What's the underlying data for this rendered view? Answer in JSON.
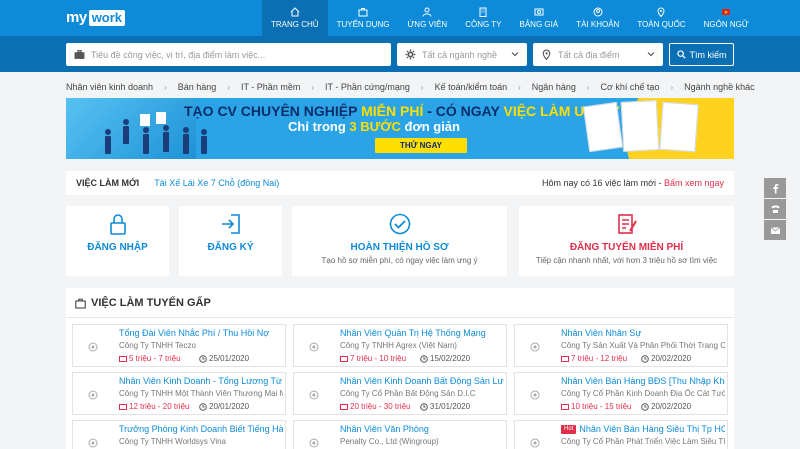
{
  "logo": {
    "my": "my",
    "work": "work"
  },
  "nav": [
    {
      "label": "TRANG CHỦ",
      "icon": "home-icon",
      "active": true
    },
    {
      "label": "TUYỂN DỤNG",
      "icon": "briefcase-icon"
    },
    {
      "label": "ỨNG VIÊN",
      "icon": "user-icon"
    },
    {
      "label": "CÔNG TY",
      "icon": "building-icon"
    },
    {
      "label": "BẢNG GIÁ",
      "icon": "price-icon"
    },
    {
      "label": "TÀI KHOẢN",
      "icon": "account-icon"
    },
    {
      "label": "TOÀN QUỐC",
      "icon": "location-icon"
    },
    {
      "label": "NGÔN NGỮ",
      "icon": "flag-icon"
    }
  ],
  "search": {
    "keyword_placeholder": "Tiêu đề công việc, vị trí, địa điểm làm việc...",
    "industry_placeholder": "Tất cả ngành nghề",
    "location_placeholder": "Tất cả địa điểm",
    "button_label": "Tìm kiếm"
  },
  "categories": [
    "Nhân viên kinh doanh",
    "Bán hàng",
    "IT - Phần mềm",
    "IT - Phần cứng/mạng",
    "Kế toán/kiểm toán",
    "Ngân hàng",
    "Cơ khí chế tạo",
    "Ngành nghề khác"
  ],
  "banner": {
    "line1_a": "TẠO CV CHUYÊN NGHIỆP ",
    "line1_b": "MIỄN PHÍ",
    "line1_c": " - CÓ NGAY ",
    "line1_d": "VIỆC LÀM ƯNG Ý",
    "line2_a": "Chỉ trong ",
    "line2_b": "3 BƯỚC",
    "line2_c": " đơn giản",
    "cta": "THỬ NGAY"
  },
  "newjobs": {
    "label": "VIỆC LÀM MỚI",
    "link": "Tài Xế Lái Xe 7 Chỗ (đồng Nai)",
    "count_text": "Hôm nay có 16 việc làm mới - ",
    "see_now": "Bấm xem ngay"
  },
  "cards": [
    {
      "title": "ĐĂNG NHẬP",
      "sub": "",
      "icon": "lock-icon",
      "color": "#0d8bd8"
    },
    {
      "title": "ĐĂNG KÝ",
      "sub": "",
      "icon": "signin-icon",
      "color": "#0d8bd8"
    },
    {
      "title": "HOÀN THIỆN HỒ SƠ",
      "sub": "Tạo hồ sơ miễn phí, có ngay việc làm ưng ý",
      "icon": "check-circle-icon",
      "color": "#0d8bd8"
    },
    {
      "title": "ĐĂNG TUYỂN MIỄN PHÍ",
      "sub": "Tiếp cận nhanh nhất, với hơn 3 triệu hồ sơ tìm việc",
      "icon": "post-job-icon",
      "color": "#e02f4a"
    }
  ],
  "urgent": {
    "title": "VIỆC LÀM TUYỂN GẤP",
    "jobs": [
      {
        "title": "Tổng Đài Viên Nhắc Phí / Thu Hồi Nợ",
        "company": "Công Ty TNHH Teczo",
        "salary": "5 triệu - 7 triệu",
        "date": "25/01/2020",
        "hot": false
      },
      {
        "title": "Nhân Viên Quản Trị Hệ Thống Mạng",
        "company": "Công Ty TNHH Agrex (Việt Nam)",
        "salary": "7 triệu - 10 triệu",
        "date": "15/02/2020",
        "hot": false
      },
      {
        "title": "Nhân Viên Nhân Sự",
        "company": "Công Ty Sản Xuất Và Phân Phối Thời Trang Ccn",
        "salary": "7 triệu - 12 triệu",
        "date": "20/02/2020",
        "hot": false
      },
      {
        "title": "Nhân Viên Kinh Doanh - Tổng Lương Từ 12t",
        "company": "Công Ty TNHH Một Thành Viên Thương Mại M...",
        "salary": "12 triệu - 20 triệu",
        "date": "20/01/2020",
        "hot": false
      },
      {
        "title": "Nhân Viên Kinh Doanh Bất Động Sản Lương",
        "company": "Công Ty Cổ Phần Bất Động Sản D.I.C",
        "salary": "20 triệu - 30 triệu",
        "date": "31/01/2020",
        "hot": false
      },
      {
        "title": "Nhân Viên Bán Hàng BĐS [Thu Nhập Khởi Đi",
        "company": "Công Ty Cổ Phần Kinh Doanh Địa Ốc Cát Tườ...",
        "salary": "10 triệu - 15 triệu",
        "date": "20/02/2020",
        "hot": false
      },
      {
        "title": "Trưởng Phòng Kinh Doanh Biết Tiếng Hàn (",
        "company": "Công Ty TNHH Worldsys Vina",
        "salary": "",
        "date": "",
        "hot": false
      },
      {
        "title": "Nhân Viên Văn Phòng",
        "company": "Penalty Co., Ltd (Wingroup)",
        "salary": "",
        "date": "",
        "hot": false
      },
      {
        "title": "Nhân Viên Bán Hàng Siêu Thị Tp HCM",
        "company": "Công Ty Cổ Phần Phát Triển Việc Làm Siêu Th...",
        "salary": "",
        "date": "",
        "hot": true,
        "hot_label": "Hot"
      }
    ]
  },
  "side": [
    "facebook-icon",
    "phone-icon",
    "mail-icon"
  ],
  "colors": {
    "primary": "#0d8bd8",
    "primary_dark": "#0a6fb3",
    "accent": "#e02f4a",
    "yellow": "#ffde00"
  }
}
